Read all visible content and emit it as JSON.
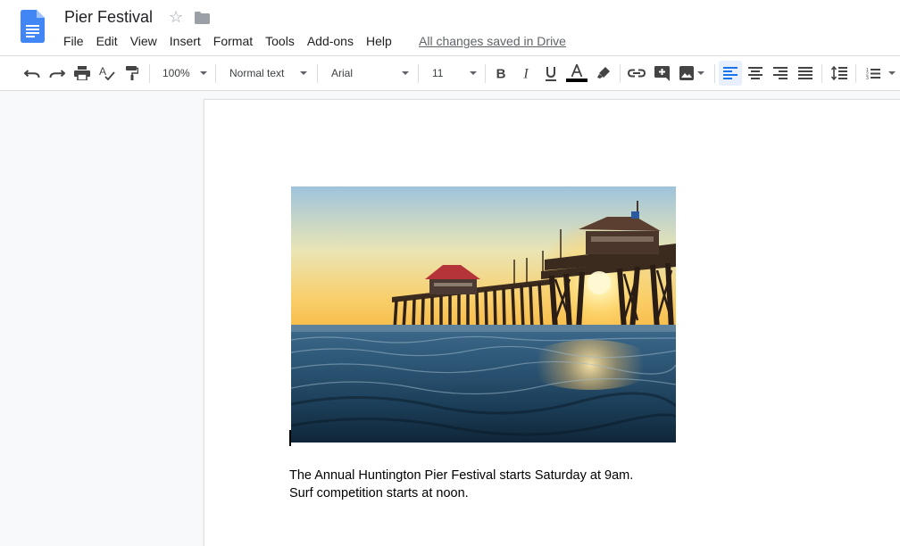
{
  "document": {
    "title": "Pier Festival",
    "save_status": "All changes saved in Drive"
  },
  "menu": {
    "items": [
      "File",
      "Edit",
      "View",
      "Insert",
      "Format",
      "Tools",
      "Add-ons",
      "Help"
    ]
  },
  "toolbar": {
    "zoom": "100%",
    "paragraph_style": "Normal text",
    "font": "Arial",
    "font_size": "11",
    "text_color": "#000000",
    "accent": "#1a73e8",
    "active_alignment": "left"
  },
  "content": {
    "image_subject": "pier-at-sunset-photo",
    "paragraph_lines": [
      "The Annual Huntington Pier Festival starts Saturday at 9am.",
      "Surf competition starts at noon."
    ]
  },
  "icons": [
    "docs-logo-icon",
    "star-icon",
    "folder-icon",
    "undo-icon",
    "redo-icon",
    "print-icon",
    "spellcheck-icon",
    "paint-format-icon",
    "bold-icon",
    "italic-icon",
    "underline-icon",
    "text-color-icon",
    "highlight-icon",
    "link-icon",
    "add-comment-icon",
    "insert-image-icon",
    "align-left-icon",
    "align-center-icon",
    "align-right-icon",
    "align-justify-icon",
    "line-spacing-icon",
    "numbered-list-icon"
  ]
}
